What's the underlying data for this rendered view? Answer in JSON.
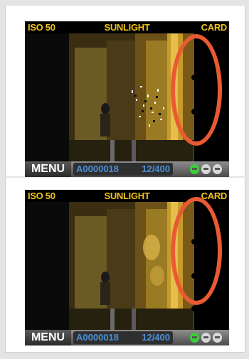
{
  "screens": [
    {
      "status": {
        "iso": "ISO 50",
        "white_balance": "SUNLIGHT",
        "media": "CARD"
      },
      "menu_label": "MENU",
      "file_id": "A0000018",
      "frame_count": "12/400",
      "battery_level": "1 of 3 segments green",
      "highlight_color": "#e95a33"
    },
    {
      "status": {
        "iso": "ISO 50",
        "white_balance": "SUNLIGHT",
        "media": "CARD"
      },
      "menu_label": "MENU",
      "file_id": "A0000018",
      "frame_count": "12/400",
      "battery_level": "1 of 3 segments green",
      "highlight_color": "#e95a33"
    }
  ]
}
